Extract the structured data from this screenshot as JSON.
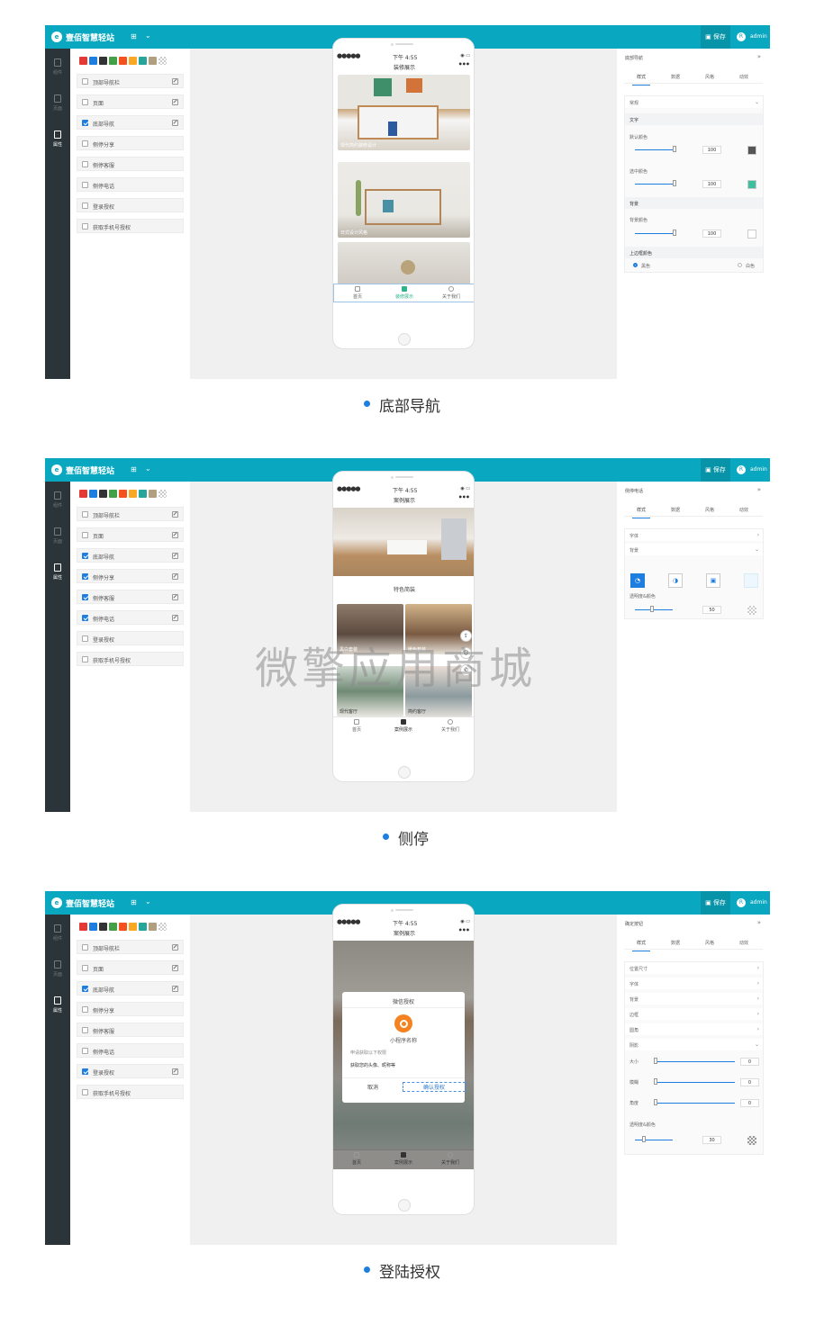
{
  "app": {
    "name": "壹佰智慧轻站",
    "save_label": "保存",
    "user": "admin",
    "avatar": "R"
  },
  "sidebar_labels": [
    "组件",
    "页面",
    "属性"
  ],
  "swatch_colors": [
    "#e53935",
    "#1e7ee0",
    "#333333",
    "#43a047",
    "#f4511e",
    "#f9a825",
    "#26a69a",
    "#b0a080"
  ],
  "right_tabs": [
    "样式",
    "数据",
    "风格",
    "动效"
  ],
  "phone_tabs": [
    "首页",
    "装修展示",
    "关于我们"
  ],
  "panels": [
    {
      "component_rows": [
        {
          "label": "顶部导航栏",
          "checked": false,
          "editable": true
        },
        {
          "label": "页面",
          "checked": false,
          "editable": true
        },
        {
          "label": "底部导航",
          "checked": true,
          "editable": true
        },
        {
          "label": "侧停分享",
          "checked": false,
          "editable": false
        },
        {
          "label": "侧停客服",
          "checked": false,
          "editable": false
        },
        {
          "label": "侧停电话",
          "checked": false,
          "editable": false
        },
        {
          "label": "登录授权",
          "checked": false,
          "editable": false
        },
        {
          "label": "获取手机号授权",
          "checked": false,
          "editable": false
        }
      ],
      "phone": {
        "time": "下午 4:55",
        "title": "装修展示",
        "cards": [
          "现代简约装修设计",
          "日式设计风格"
        ],
        "tabs": [
          "首页",
          "装修展示",
          "关于我们"
        ]
      },
      "props": {
        "header": "底部导航",
        "select": "常规",
        "text_section": "文字",
        "default_color": "默认颜色",
        "selected_color": "选中颜色",
        "bg_section": "背景",
        "bg_color": "背景颜色",
        "border_color": "上边框颜色",
        "black": "黑色",
        "white": "白色",
        "values": [
          "100",
          "100",
          "100"
        ],
        "colors": [
          "#555555",
          "#3cc0a0",
          "#ffffff"
        ]
      },
      "caption": "底部导航"
    },
    {
      "component_rows": [
        {
          "label": "顶部导航栏",
          "checked": false,
          "editable": true
        },
        {
          "label": "页面",
          "checked": false,
          "editable": true
        },
        {
          "label": "底部导航",
          "checked": true,
          "editable": true
        },
        {
          "label": "侧停分享",
          "checked": true,
          "editable": true
        },
        {
          "label": "侧停客服",
          "checked": true,
          "editable": true
        },
        {
          "label": "侧停电话",
          "checked": true,
          "editable": true
        },
        {
          "label": "登录授权",
          "checked": false,
          "editable": false
        },
        {
          "label": "获取手机号授权",
          "checked": false,
          "editable": false
        }
      ],
      "phone": {
        "time": "下午 4:55",
        "title": "案例展示",
        "section": "特色简装",
        "cards": [
          "黑白套装",
          "暖色套装",
          "现代客厅",
          "简约客厅"
        ],
        "tabs": [
          "首页",
          "案例展示",
          "关于我们"
        ]
      },
      "props": {
        "header": "侧停电话",
        "font": "字体",
        "bg_section": "背景",
        "opacity": "透明度&颜色",
        "value": "50"
      },
      "caption": "侧停"
    },
    {
      "component_rows": [
        {
          "label": "顶部导航栏",
          "checked": false,
          "editable": true
        },
        {
          "label": "页面",
          "checked": false,
          "editable": true
        },
        {
          "label": "底部导航",
          "checked": true,
          "editable": true
        },
        {
          "label": "侧停分享",
          "checked": false,
          "editable": false
        },
        {
          "label": "侧停客服",
          "checked": false,
          "editable": false
        },
        {
          "label": "侧停电话",
          "checked": false,
          "editable": false
        },
        {
          "label": "登录授权",
          "checked": true,
          "editable": true
        },
        {
          "label": "获取手机号授权",
          "checked": false,
          "editable": false
        }
      ],
      "phone": {
        "time": "下午 4:55",
        "title": "案例展示",
        "tabs": [
          "首页",
          "案例展示",
          "关于我们"
        ]
      },
      "modal": {
        "title": "微信授权",
        "app_name": "小程序名称",
        "request": "申请获取以下权限",
        "desc": "获取您的头像、昵称等",
        "cancel": "取消",
        "confirm": "确认授权"
      },
      "props": {
        "header": "确定按钮",
        "items": [
          "位置尺寸",
          "字体",
          "背景",
          "边框",
          "圆角",
          "阴影"
        ],
        "shadow_rows": [
          "大小",
          "模糊",
          "角度"
        ],
        "shadow_values": [
          "0",
          "0",
          "0"
        ],
        "opacity": "透明度&颜色",
        "value": "30"
      },
      "caption": "登陆授权"
    }
  ],
  "watermark": "微擎应用商城"
}
